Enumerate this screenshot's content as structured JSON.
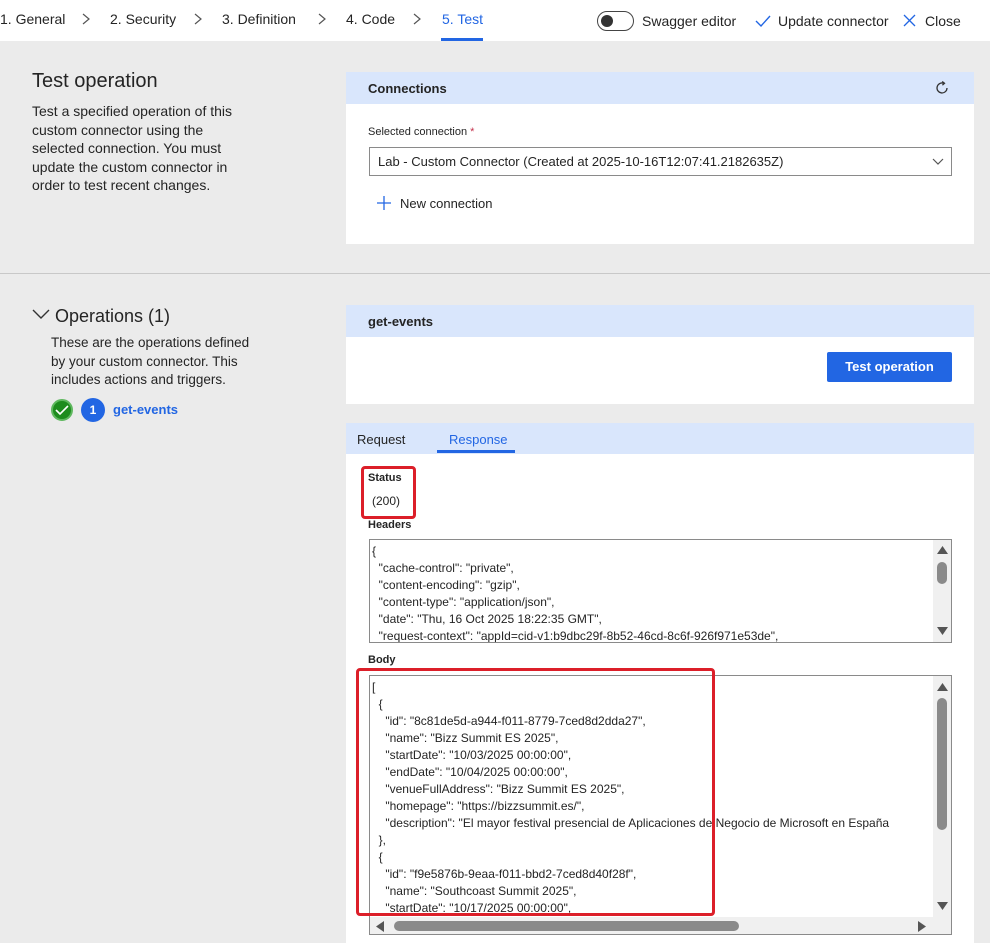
{
  "nav": {
    "steps": [
      "1. General",
      "2. Security",
      "3. Definition",
      "4. Code",
      "5. Test"
    ],
    "swagger_label": "Swagger editor",
    "update_label": "Update connector",
    "close_label": "Close"
  },
  "test_section": {
    "title": "Test operation",
    "description": [
      "Test a specified operation of this",
      "custom connector using the",
      "selected connection. You must",
      "update the custom connector in",
      "order to test recent changes."
    ]
  },
  "connections": {
    "header": "Connections",
    "selected_label": "Selected connection",
    "required_mark": "*",
    "selected_value": "Lab - Custom Connector (Created at 2025-10-16T12:07:41.2182635Z)",
    "new_connection_label": "New connection"
  },
  "operations": {
    "title": "Operations (1)",
    "description": [
      "These are the operations defined",
      "by your custom connector. This",
      "includes actions and triggers."
    ],
    "item_number": "1",
    "item_name": "get-events"
  },
  "operation_card": {
    "title": "get-events",
    "test_button": "Test operation"
  },
  "response": {
    "tabs": [
      "Request",
      "Response"
    ],
    "status_label": "Status",
    "status_value": "(200)",
    "headers_label": "Headers",
    "headers_lines": [
      "{",
      "  \"cache-control\": \"private\",",
      "  \"content-encoding\": \"gzip\",",
      "  \"content-type\": \"application/json\",",
      "  \"date\": \"Thu, 16 Oct 2025 18:22:35 GMT\",",
      "  \"request-context\": \"appId=cid-v1:b9dbc29f-8b52-46cd-8c6f-926f971e53de\","
    ],
    "body_label": "Body",
    "body_lines": [
      "[",
      "  {",
      "    \"id\": \"8c81de5d-a944-f011-8779-7ced8d2dda27\",",
      "    \"name\": \"Bizz Summit ES 2025\",",
      "    \"startDate\": \"10/03/2025 00:00:00\",",
      "    \"endDate\": \"10/04/2025 00:00:00\",",
      "    \"venueFullAddress\": \"Bizz Summit ES 2025\",",
      "    \"homepage\": \"https://bizzsummit.es/\",",
      "    \"description\": \"El mayor festival presencial de Aplicaciones de Negocio de Microsoft en España",
      "  },",
      "  {",
      "    \"id\": \"f9e5876b-9eaa-f011-bbd2-7ced8d40f28f\",",
      "    \"name\": \"Southcoast Summit 2025\",",
      "    \"startDate\": \"10/17/2025 00:00:00\","
    ]
  },
  "colors": {
    "accent": "#2266e3",
    "card_header": "#d9e6fc",
    "highlight_red": "#dc1f29",
    "success_green": "#1e8c1e"
  }
}
